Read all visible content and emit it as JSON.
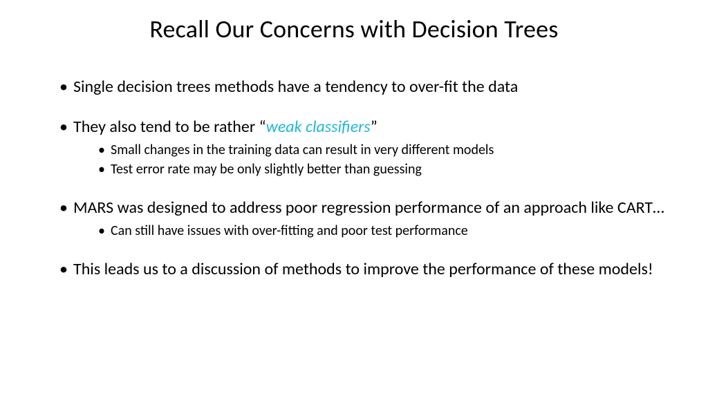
{
  "title": "Recall Our Concerns with Decision Trees",
  "bullets": {
    "b1": "Single decision trees methods have a tendency to over-fit the data",
    "b2_pre": "They also tend to be rather “",
    "b2_emph": "weak classifiers",
    "b2_post": "”",
    "b2_sub1": "Small changes in the training data can result in very different models",
    "b2_sub2": "Test error rate may be only slightly better than guessing",
    "b3": "MARS was designed to address poor regression performance of an approach like CART…",
    "b3_sub1": "Can still have issues with over-fitting and poor test performance",
    "b4": "This leads us to a discussion of methods to improve the performance of these models!"
  }
}
